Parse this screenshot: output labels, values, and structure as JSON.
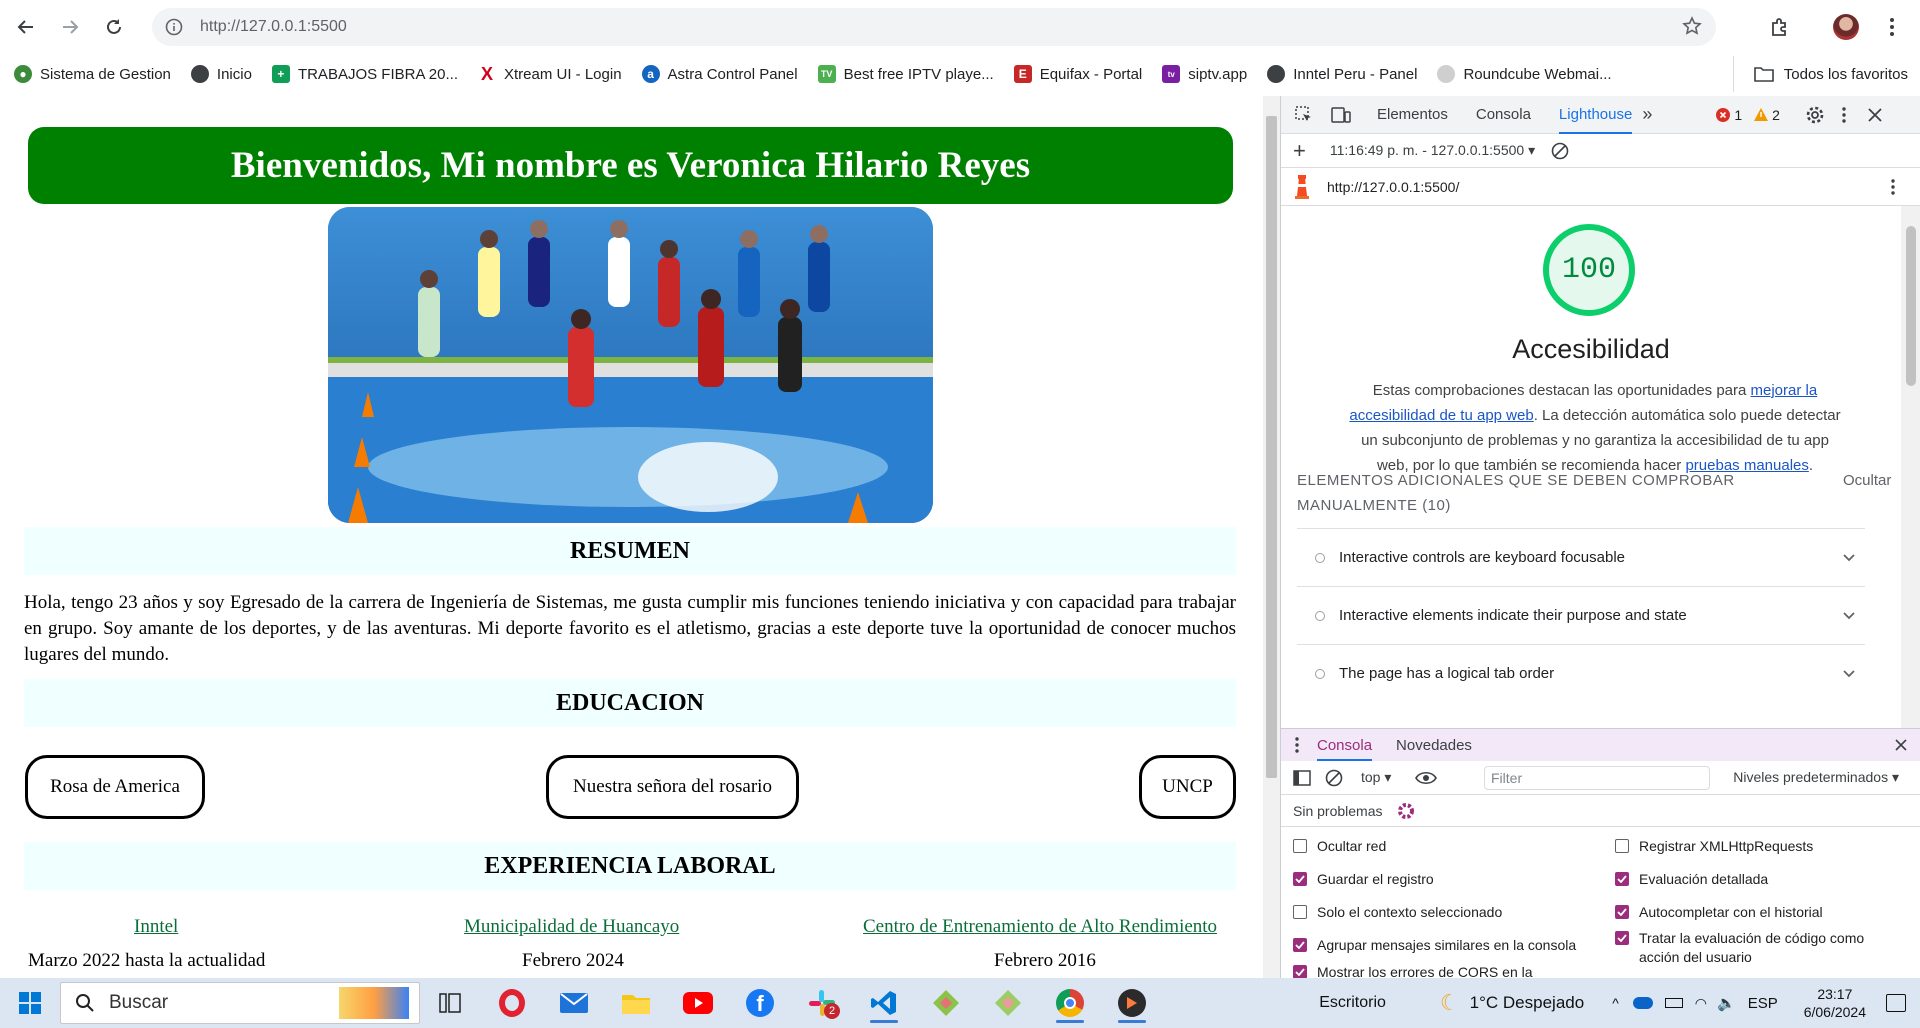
{
  "browser": {
    "url": "http://127.0.0.1:5500",
    "bookmarks": [
      {
        "label": "Sistema de Gestion",
        "icon": "leaf-icon",
        "color": "#3c8a3c"
      },
      {
        "label": "Inicio",
        "icon": "globe-icon",
        "color": "#3c4043"
      },
      {
        "label": "TRABAJOS FIBRA 20...",
        "icon": "sheets-icon",
        "color": "#0f9d58"
      },
      {
        "label": "Xtream UI - Login",
        "icon": "x-logo-icon",
        "color": "#d0021b"
      },
      {
        "label": "Astra Control Panel",
        "icon": "astra-icon",
        "color": "#1565c0"
      },
      {
        "label": "Best free IPTV playe...",
        "icon": "iptv-icon",
        "color": "#4caf50"
      },
      {
        "label": "Equifax - Portal",
        "icon": "equifax-icon",
        "color": "#c62828"
      },
      {
        "label": "siptv.app",
        "icon": "siptv-icon",
        "color": "#7b1fa2"
      },
      {
        "label": "Inntel Peru - Panel",
        "icon": "globe-icon",
        "color": "#3c4043"
      },
      {
        "label": "Roundcube Webmai...",
        "icon": "roundcube-icon",
        "color": "#9e9e9e"
      }
    ],
    "all_bookmarks": "Todos los favoritos"
  },
  "page": {
    "banner": "Bienvenidos, Mi nombre es Veronica Hilario Reyes",
    "resumen_title": "RESUMEN",
    "resumen_text": "Hola, tengo 23 años y soy Egresado de la carrera de Ingeniería de Sistemas, me gusta cumplir mis funciones teniendo iniciativa y con capacidad para trabajar en grupo. Soy amante de los deportes, y de las aventuras. Mi deporte favorito es el atletismo, gracias a este deporte tuve la oportunidad de conocer muchos lugares del mundo.",
    "educacion_title": "EDUCACION",
    "schools": [
      "Rosa de America",
      "Nuestra señora del rosario",
      "UNCP"
    ],
    "experiencia_title": "EXPERIENCIA LABORAL",
    "jobs": [
      {
        "name": "Inntel",
        "date": "Marzo 2022 hasta la actualidad"
      },
      {
        "name": "Municipalidad de Huancayo",
        "date": "Febrero 2024"
      },
      {
        "name": "Centro de Entrenamiento de Alto Rendimiento",
        "date": "Febrero 2016"
      }
    ]
  },
  "devtools": {
    "tabs": [
      "Elementos",
      "Consola",
      "Lighthouse"
    ],
    "active_tab": "Lighthouse",
    "errors": "1",
    "warnings": "2",
    "report_select": "11:16:49 p. m. - 127.0.0.1:5500",
    "report_url": "http://127.0.0.1:5500/",
    "score": "100",
    "category": "Accesibilidad",
    "desc_pre": "Estas comprobaciones destacan las oportunidades para ",
    "desc_link1": "mejorar la accesibilidad de tu app web",
    "desc_mid": ". La detección automática solo puede detectar un subconjunto de problemas y no garantiza la accesibilidad de tu app web, por lo que también se recomienda hacer ",
    "desc_link2": "pruebas manuales",
    "desc_post": ".",
    "manual_heading": "ELEMENTOS ADICIONALES QUE SE DEBEN COMPROBAR MANUALMENTE",
    "manual_count": "(10)",
    "hide": "Ocultar",
    "audits": [
      "Interactive controls are keyboard focusable",
      "Interactive elements indicate their purpose and state",
      "The page has a logical tab order"
    ],
    "drawer_tabs": [
      "Consola",
      "Novedades"
    ],
    "context": "top",
    "filter_placeholder": "Filter",
    "levels": "Niveles predeterminados",
    "no_issues": "Sin problemas",
    "options_left": [
      {
        "label": "Ocultar red",
        "checked": false
      },
      {
        "label": "Guardar el registro",
        "checked": true
      },
      {
        "label": "Solo el contexto seleccionado",
        "checked": false
      },
      {
        "label": "Agrupar mensajes similares en la consola",
        "checked": true
      },
      {
        "label": "Mostrar los errores de CORS en la",
        "checked": true
      }
    ],
    "options_right": [
      {
        "label": "Registrar XMLHttpRequests",
        "checked": false
      },
      {
        "label": "Evaluación detallada",
        "checked": true
      },
      {
        "label": "Autocompletar con el historial",
        "checked": true
      },
      {
        "label": "Tratar la evaluación de código como acción del usuario",
        "checked": true
      }
    ]
  },
  "taskbar": {
    "search": "Buscar",
    "desktop": "Escritorio",
    "weather": "1°C  Despejado",
    "lang": "ESP",
    "time": "23:17",
    "date": "6/06/2024",
    "slack_badge": "2"
  }
}
